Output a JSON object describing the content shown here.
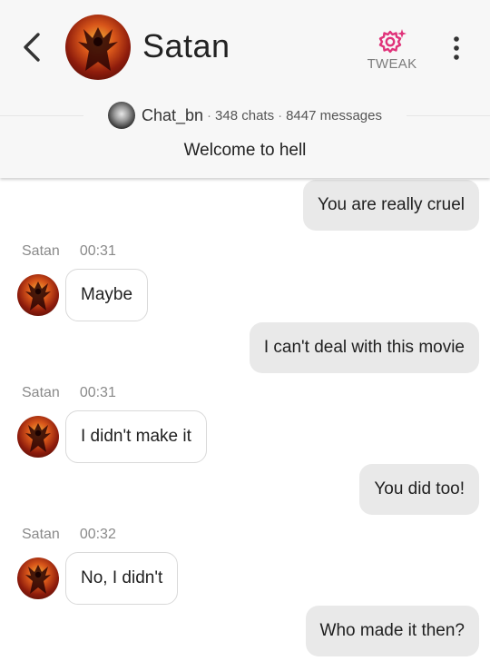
{
  "header": {
    "title": "Satan",
    "tweak_label": "TWEAK",
    "creator": {
      "name": "Chat_bn",
      "chats": "348 chats",
      "messages": "8447 messages"
    },
    "separator": "·",
    "welcome": "Welcome to hell"
  },
  "bot": {
    "name": "Satan"
  },
  "messages": [
    {
      "role": "user",
      "text": "You are really cruel"
    },
    {
      "role": "bot",
      "time": "00:31",
      "text": "Maybe"
    },
    {
      "role": "user",
      "text": "I can't deal with this movie"
    },
    {
      "role": "bot",
      "time": "00:31",
      "text": "I didn't make it"
    },
    {
      "role": "user",
      "text": "You did too!"
    },
    {
      "role": "bot",
      "time": "00:32",
      "text": "No, I didn't"
    },
    {
      "role": "user",
      "text": "Who made it then?"
    }
  ],
  "colors": {
    "accent": "#e0337a",
    "header_bg": "#f7f7f7",
    "user_bubble": "#e9e9e9",
    "bot_bubble": "#ffffff"
  },
  "icons": {
    "back": "chevron-left-icon",
    "tweak": "gear-sparkle-icon",
    "more": "vertical-dots-icon"
  }
}
